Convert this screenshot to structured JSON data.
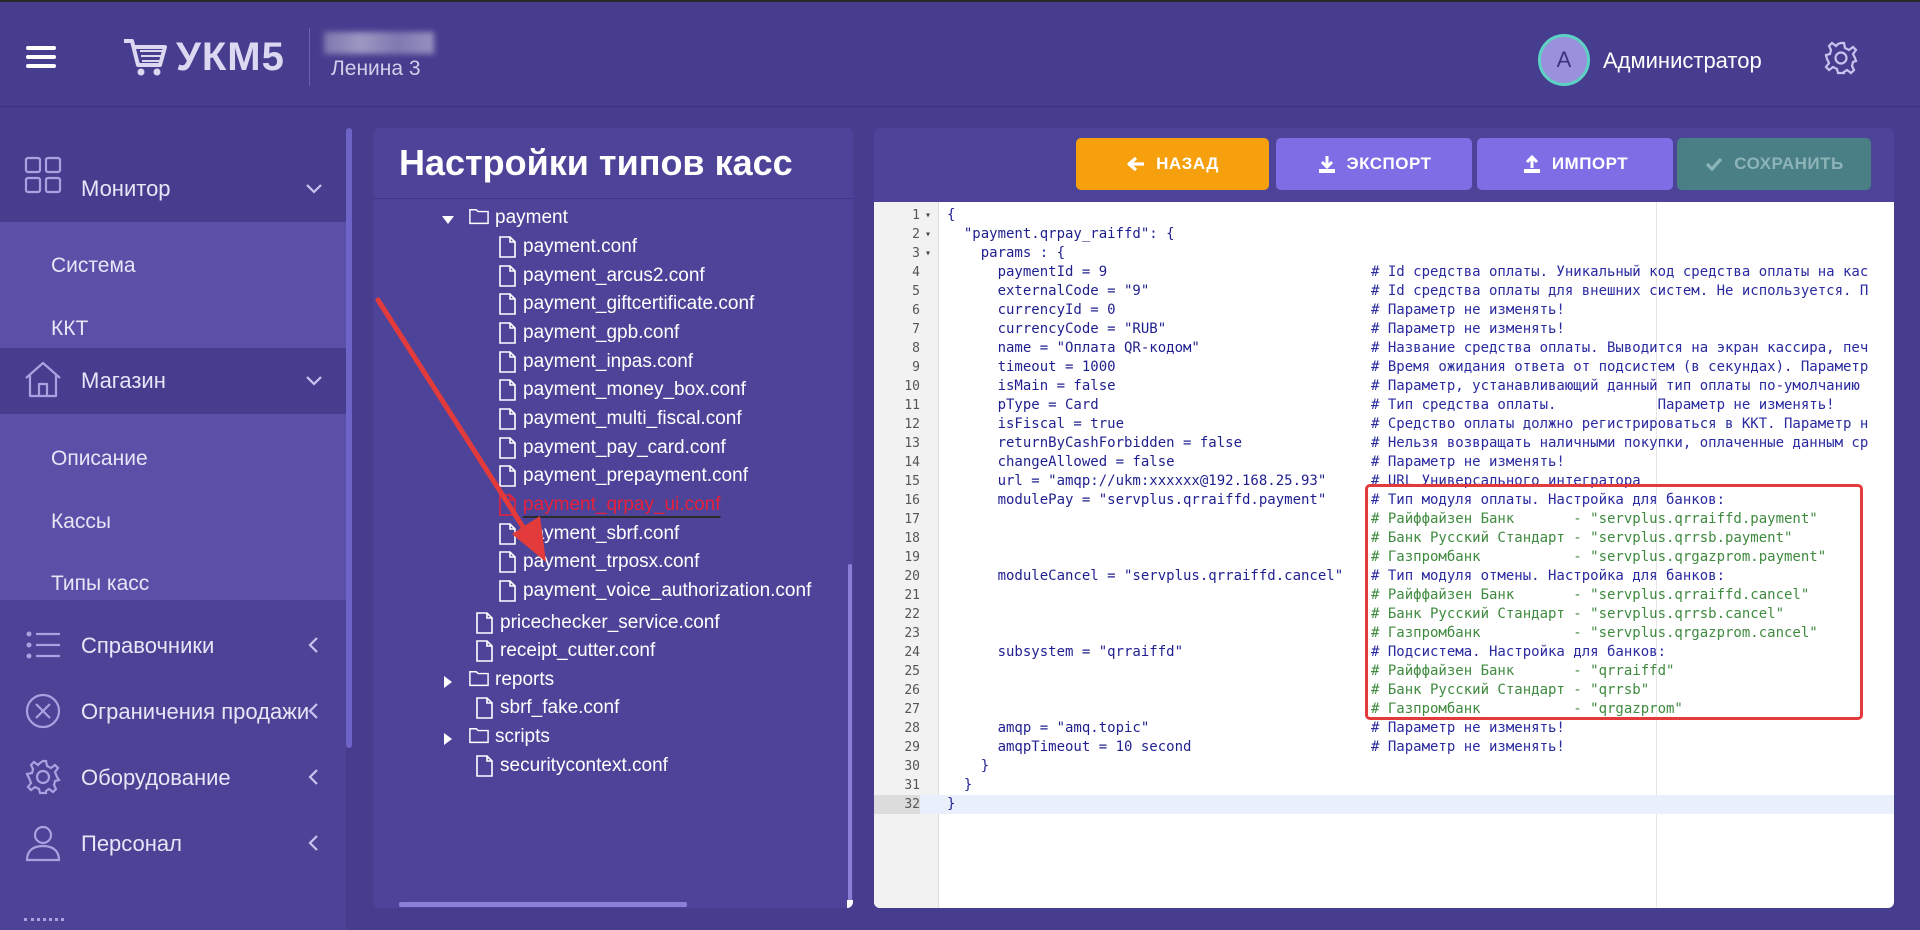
{
  "app": {
    "logo_text": "УКМ5",
    "store_name": "Ленина 3",
    "user_initial": "A",
    "user_name": "Администратор"
  },
  "sidebar": {
    "groups": [
      {
        "label": "Монитор",
        "icon": "monitor-grid-icon",
        "chevron": "down"
      },
      {
        "label": "Магазин",
        "icon": "home-icon",
        "chevron": "down"
      },
      {
        "label": "Справочники",
        "icon": "list-icon",
        "chevron": "left"
      },
      {
        "label": "Ограничения продажи",
        "icon": "cross-circle-icon",
        "chevron": "left"
      },
      {
        "label": "Оборудование",
        "icon": "gear-icon",
        "chevron": "left"
      },
      {
        "label": "Персонал",
        "icon": "person-icon",
        "chevron": "left"
      }
    ],
    "monitor_items": [
      "Система",
      "ККТ"
    ],
    "store_items": [
      "Описание",
      "Кассы",
      "Типы касс"
    ]
  },
  "tree": {
    "title": "Настройки типов касс",
    "rows": [
      {
        "label": "payment",
        "type": "folder",
        "expanded": true,
        "level": 1
      },
      {
        "label": "payment.conf",
        "type": "file",
        "level": 2
      },
      {
        "label": "payment_arcus2.conf",
        "type": "file",
        "level": 2
      },
      {
        "label": "payment_giftcertificate.conf",
        "type": "file",
        "level": 2
      },
      {
        "label": "payment_gpb.conf",
        "type": "file",
        "level": 2
      },
      {
        "label": "payment_inpas.conf",
        "type": "file",
        "level": 2
      },
      {
        "label": "payment_money_box.conf",
        "type": "file",
        "level": 2
      },
      {
        "label": "payment_multi_fiscal.conf",
        "type": "file",
        "level": 2
      },
      {
        "label": "payment_pay_card.conf",
        "type": "file",
        "level": 2
      },
      {
        "label": "payment_prepayment.conf",
        "type": "file",
        "level": 2
      },
      {
        "label": "payment_qrpay_ui.conf",
        "type": "file",
        "level": 2,
        "selected": true
      },
      {
        "label": "payment_sbrf.conf",
        "type": "file",
        "level": 2
      },
      {
        "label": "payment_trposx.conf",
        "type": "file",
        "level": 2
      },
      {
        "label": "payment_voice_authorization.conf",
        "type": "file",
        "level": 2
      },
      {
        "label": "pricechecker_service.conf",
        "type": "file",
        "level": 1
      },
      {
        "label": "receipt_cutter.conf",
        "type": "file",
        "level": 1
      },
      {
        "label": "reports",
        "type": "folder",
        "expanded": false,
        "level": 1
      },
      {
        "label": "sbrf_fake.conf",
        "type": "file",
        "level": 1
      },
      {
        "label": "scripts",
        "type": "folder",
        "expanded": false,
        "level": 1
      },
      {
        "label": "securitycontext.conf",
        "type": "file",
        "level": 1
      }
    ]
  },
  "toolbar": {
    "back_label": "НАЗАД",
    "export_label": "ЭКСПОРТ",
    "import_label": "ИМПОРТ",
    "save_label": "СОХРАНИТЬ"
  },
  "colors": {
    "background": "#473d8f",
    "back_button": "#f7a00d",
    "action_button": "#7d6ee6",
    "save_button_disabled": "#4a7f85",
    "selected_file": "#e8203a",
    "highlight_box": "#e33b3b"
  },
  "code": {
    "current_line": 32,
    "lines": [
      {
        "n": "1",
        "fold": "▾",
        "text": "{",
        "comment": ""
      },
      {
        "n": "2",
        "fold": "▾",
        "text": "  \"payment.qrpay_raiffd\": {",
        "comment": ""
      },
      {
        "n": "3",
        "fold": "▾",
        "text": "    params : {",
        "comment": ""
      },
      {
        "n": "4",
        "fold": "",
        "text": "      paymentId = 9",
        "comment": "# Id средства оплаты. Уникальный код средства оплаты на кас"
      },
      {
        "n": "5",
        "fold": "",
        "text": "      externalCode = \"9\"",
        "comment": "# Id средства оплаты для внешних систем. Не используется. П"
      },
      {
        "n": "6",
        "fold": "",
        "text": "      currencyId = 0",
        "comment": "# Параметр не изменять!"
      },
      {
        "n": "7",
        "fold": "",
        "text": "      currencyCode = \"RUB\"",
        "comment": "# Параметр не изменять!"
      },
      {
        "n": "8",
        "fold": "",
        "text": "      name = \"Оплата QR-кодом\"",
        "comment": "# Название средства оплаты. Выводится на экран кассира, печ"
      },
      {
        "n": "9",
        "fold": "",
        "text": "      timeout = 1000",
        "comment": "# Время ожидания ответа от подсистем (в секундах). Параметр"
      },
      {
        "n": "10",
        "fold": "",
        "text": "      isMain = false",
        "comment": "# Параметр, устанавливающий данный тип оплаты по-умолчанию"
      },
      {
        "n": "11",
        "fold": "",
        "text": "      pType = Card",
        "comment": "# Тип средства оплаты.            Параметр не изменять!"
      },
      {
        "n": "12",
        "fold": "",
        "text": "      isFiscal = true",
        "comment": "# Средство оплаты должно регистрироваться в ККТ. Параметр н"
      },
      {
        "n": "13",
        "fold": "",
        "text": "      returnByCashForbidden = false",
        "comment": "# Нельзя возвращать наличными покупки, оплаченные данным ср"
      },
      {
        "n": "14",
        "fold": "",
        "text": "      changeAllowed = false",
        "comment": "# Параметр не изменять!"
      },
      {
        "n": "15",
        "fold": "",
        "text": "      url = \"amqp://ukm:xxxxxx@192.168.25.93\"",
        "comment": "# URL Универсального интегратора"
      },
      {
        "n": "16",
        "fold": "",
        "text": "      modulePay = \"servplus.qrraiffd.payment\"",
        "comment": "# Тип модуля оплаты. Настройка для банков:"
      },
      {
        "n": "17",
        "fold": "",
        "text": "",
        "comment": "# Райффайзен Банк       - \"servplus.qrraiffd.payment\"",
        "green": true
      },
      {
        "n": "18",
        "fold": "",
        "text": "",
        "comment": "# Банк Русский Стандарт - \"servplus.qrrsb.payment\"",
        "green": true
      },
      {
        "n": "19",
        "fold": "",
        "text": "",
        "comment": "# Газпромбанк           - \"servplus.qrgazprom.payment\"",
        "green": true
      },
      {
        "n": "20",
        "fold": "",
        "text": "      moduleCancel = \"servplus.qrraiffd.cancel\"",
        "comment": "# Тип модуля отмены. Настройка для банков:"
      },
      {
        "n": "21",
        "fold": "",
        "text": "",
        "comment": "# Райффайзен Банк       - \"servplus.qrraiffd.cancel\"",
        "green": true
      },
      {
        "n": "22",
        "fold": "",
        "text": "",
        "comment": "# Банк Русский Стандарт - \"servplus.qrrsb.cancel\"",
        "green": true
      },
      {
        "n": "23",
        "fold": "",
        "text": "",
        "comment": "# Газпромбанк           - \"servplus.qrgazprom.cancel\"",
        "green": true
      },
      {
        "n": "24",
        "fold": "",
        "text": "      subsystem = \"qrraiffd\"",
        "comment": "# Подсистема. Настройка для банков:"
      },
      {
        "n": "25",
        "fold": "",
        "text": "",
        "comment": "# Райффайзен Банк       - \"qrraiffd\"",
        "green": true
      },
      {
        "n": "26",
        "fold": "",
        "text": "",
        "comment": "# Банк Русский Стандарт - \"qrrsb\"",
        "green": true
      },
      {
        "n": "27",
        "fold": "",
        "text": "",
        "comment": "# Газпромбанк           - \"qrgazprom\"",
        "green": true
      },
      {
        "n": "28",
        "fold": "",
        "text": "      amqp = \"amq.topic\"",
        "comment": "# Параметр не изменять!"
      },
      {
        "n": "29",
        "fold": "",
        "text": "      amqpTimeout = 10 second",
        "comment": "# Параметр не изменять!"
      },
      {
        "n": "30",
        "fold": "",
        "text": "    }",
        "comment": ""
      },
      {
        "n": "31",
        "fold": "",
        "text": "  }",
        "comment": ""
      },
      {
        "n": "32",
        "fold": "",
        "text": "}",
        "comment": ""
      }
    ]
  }
}
